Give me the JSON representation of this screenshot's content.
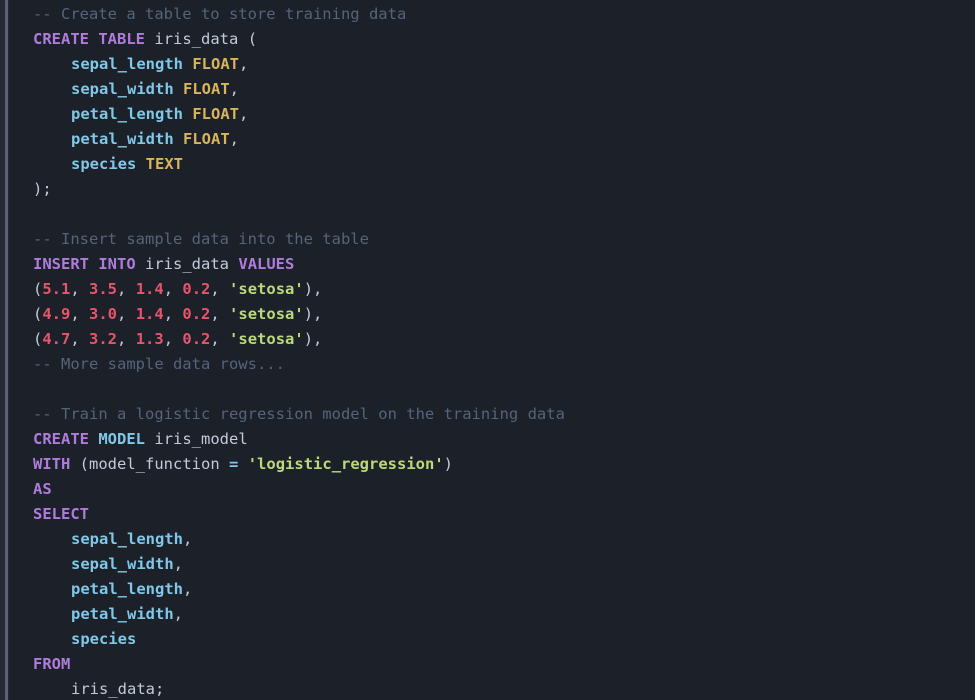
{
  "editor": {
    "language": "sql",
    "theme": "dark-navy",
    "background_color": "#1b2029",
    "gutter_color": "#242933",
    "gutter_rule_color": "#5a6273",
    "colors": {
      "comment": "#55647a",
      "keyword": "#b07cdb",
      "type": "#d8b45a",
      "identifier": "#f2f5fa",
      "field": "#7fc8e8",
      "number": "#e8546c",
      "string": "#bcd97a",
      "punctuation": "#c3cad9",
      "operator": "#7fc8e8"
    }
  },
  "code_lines": [
    {
      "id": "line-1",
      "indent": 0,
      "tokens": [
        {
          "t": "comment",
          "v": "-- Create a table to store training data"
        }
      ]
    },
    {
      "id": "line-2",
      "indent": 0,
      "tokens": [
        {
          "t": "keyword",
          "v": "CREATE"
        },
        {
          "t": "plain",
          "v": " "
        },
        {
          "t": "keyword",
          "v": "TABLE"
        },
        {
          "t": "plain",
          "v": " "
        },
        {
          "t": "identifier",
          "v": "iris_data"
        },
        {
          "t": "plain",
          "v": " "
        },
        {
          "t": "punctuation",
          "v": "("
        }
      ]
    },
    {
      "id": "line-3",
      "indent": 1,
      "tokens": [
        {
          "t": "field",
          "v": "sepal_length"
        },
        {
          "t": "plain",
          "v": " "
        },
        {
          "t": "type",
          "v": "FLOAT"
        },
        {
          "t": "punctuation",
          "v": ","
        }
      ]
    },
    {
      "id": "line-4",
      "indent": 1,
      "tokens": [
        {
          "t": "field",
          "v": "sepal_width"
        },
        {
          "t": "plain",
          "v": " "
        },
        {
          "t": "type",
          "v": "FLOAT"
        },
        {
          "t": "punctuation",
          "v": ","
        }
      ]
    },
    {
      "id": "line-5",
      "indent": 1,
      "tokens": [
        {
          "t": "field",
          "v": "petal_length"
        },
        {
          "t": "plain",
          "v": " "
        },
        {
          "t": "type",
          "v": "FLOAT"
        },
        {
          "t": "punctuation",
          "v": ","
        }
      ]
    },
    {
      "id": "line-6",
      "indent": 1,
      "tokens": [
        {
          "t": "field",
          "v": "petal_width"
        },
        {
          "t": "plain",
          "v": " "
        },
        {
          "t": "type",
          "v": "FLOAT"
        },
        {
          "t": "punctuation",
          "v": ","
        }
      ]
    },
    {
      "id": "line-7",
      "indent": 1,
      "tokens": [
        {
          "t": "field",
          "v": "species"
        },
        {
          "t": "plain",
          "v": " "
        },
        {
          "t": "type",
          "v": "TEXT"
        }
      ]
    },
    {
      "id": "line-8",
      "indent": 0,
      "tokens": [
        {
          "t": "punctuation",
          "v": ");"
        }
      ]
    },
    {
      "id": "line-9",
      "indent": 0,
      "tokens": []
    },
    {
      "id": "line-10",
      "indent": 0,
      "tokens": [
        {
          "t": "comment",
          "v": "-- Insert sample data into the table"
        }
      ]
    },
    {
      "id": "line-11",
      "indent": 0,
      "tokens": [
        {
          "t": "keyword",
          "v": "INSERT"
        },
        {
          "t": "plain",
          "v": " "
        },
        {
          "t": "keyword",
          "v": "INTO"
        },
        {
          "t": "plain",
          "v": " "
        },
        {
          "t": "identifier",
          "v": "iris_data"
        },
        {
          "t": "plain",
          "v": " "
        },
        {
          "t": "keyword",
          "v": "VALUES"
        }
      ]
    },
    {
      "id": "line-12",
      "indent": 0,
      "tokens": [
        {
          "t": "punctuation",
          "v": "("
        },
        {
          "t": "number",
          "v": "5.1"
        },
        {
          "t": "punctuation",
          "v": ", "
        },
        {
          "t": "number",
          "v": "3.5"
        },
        {
          "t": "punctuation",
          "v": ", "
        },
        {
          "t": "number",
          "v": "1.4"
        },
        {
          "t": "punctuation",
          "v": ", "
        },
        {
          "t": "number",
          "v": "0.2"
        },
        {
          "t": "punctuation",
          "v": ", "
        },
        {
          "t": "string",
          "v": "'setosa'"
        },
        {
          "t": "punctuation",
          "v": "),"
        }
      ]
    },
    {
      "id": "line-13",
      "indent": 0,
      "tokens": [
        {
          "t": "punctuation",
          "v": "("
        },
        {
          "t": "number",
          "v": "4.9"
        },
        {
          "t": "punctuation",
          "v": ", "
        },
        {
          "t": "number",
          "v": "3.0"
        },
        {
          "t": "punctuation",
          "v": ", "
        },
        {
          "t": "number",
          "v": "1.4"
        },
        {
          "t": "punctuation",
          "v": ", "
        },
        {
          "t": "number",
          "v": "0.2"
        },
        {
          "t": "punctuation",
          "v": ", "
        },
        {
          "t": "string",
          "v": "'setosa'"
        },
        {
          "t": "punctuation",
          "v": "),"
        }
      ]
    },
    {
      "id": "line-14",
      "indent": 0,
      "tokens": [
        {
          "t": "punctuation",
          "v": "("
        },
        {
          "t": "number",
          "v": "4.7"
        },
        {
          "t": "punctuation",
          "v": ", "
        },
        {
          "t": "number",
          "v": "3.2"
        },
        {
          "t": "punctuation",
          "v": ", "
        },
        {
          "t": "number",
          "v": "1.3"
        },
        {
          "t": "punctuation",
          "v": ", "
        },
        {
          "t": "number",
          "v": "0.2"
        },
        {
          "t": "punctuation",
          "v": ", "
        },
        {
          "t": "string",
          "v": "'setosa'"
        },
        {
          "t": "punctuation",
          "v": "),"
        }
      ]
    },
    {
      "id": "line-15",
      "indent": 0,
      "tokens": [
        {
          "t": "comment",
          "v": "-- More sample data rows..."
        }
      ]
    },
    {
      "id": "line-16",
      "indent": 0,
      "tokens": []
    },
    {
      "id": "line-17",
      "indent": 0,
      "tokens": [
        {
          "t": "comment",
          "v": "-- Train a logistic regression model on the training data"
        }
      ]
    },
    {
      "id": "line-18",
      "indent": 0,
      "tokens": [
        {
          "t": "keyword",
          "v": "CREATE"
        },
        {
          "t": "plain",
          "v": " "
        },
        {
          "t": "operator",
          "v": "MODEL"
        },
        {
          "t": "plain",
          "v": " "
        },
        {
          "t": "identifier",
          "v": "iris_model"
        }
      ]
    },
    {
      "id": "line-19",
      "indent": 0,
      "tokens": [
        {
          "t": "keyword",
          "v": "WITH"
        },
        {
          "t": "plain",
          "v": " "
        },
        {
          "t": "punctuation",
          "v": "("
        },
        {
          "t": "identifier",
          "v": "model_function"
        },
        {
          "t": "plain",
          "v": " "
        },
        {
          "t": "operator",
          "v": "="
        },
        {
          "t": "plain",
          "v": " "
        },
        {
          "t": "string",
          "v": "'logistic_regression'"
        },
        {
          "t": "punctuation",
          "v": ")"
        }
      ]
    },
    {
      "id": "line-20",
      "indent": 0,
      "tokens": [
        {
          "t": "keyword",
          "v": "AS"
        }
      ]
    },
    {
      "id": "line-21",
      "indent": 0,
      "tokens": [
        {
          "t": "keyword",
          "v": "SELECT"
        }
      ]
    },
    {
      "id": "line-22",
      "indent": 1,
      "tokens": [
        {
          "t": "field",
          "v": "sepal_length"
        },
        {
          "t": "punctuation",
          "v": ","
        }
      ]
    },
    {
      "id": "line-23",
      "indent": 1,
      "tokens": [
        {
          "t": "field",
          "v": "sepal_width"
        },
        {
          "t": "punctuation",
          "v": ","
        }
      ]
    },
    {
      "id": "line-24",
      "indent": 1,
      "tokens": [
        {
          "t": "field",
          "v": "petal_length"
        },
        {
          "t": "punctuation",
          "v": ","
        }
      ]
    },
    {
      "id": "line-25",
      "indent": 1,
      "tokens": [
        {
          "t": "field",
          "v": "petal_width"
        },
        {
          "t": "punctuation",
          "v": ","
        }
      ]
    },
    {
      "id": "line-26",
      "indent": 1,
      "tokens": [
        {
          "t": "field",
          "v": "species"
        }
      ]
    },
    {
      "id": "line-27",
      "indent": 0,
      "tokens": [
        {
          "t": "keyword",
          "v": "FROM"
        }
      ]
    },
    {
      "id": "line-28",
      "indent": 1,
      "tokens": [
        {
          "t": "identifier",
          "v": "iris_data"
        },
        {
          "t": "punctuation",
          "v": ";"
        }
      ]
    }
  ]
}
